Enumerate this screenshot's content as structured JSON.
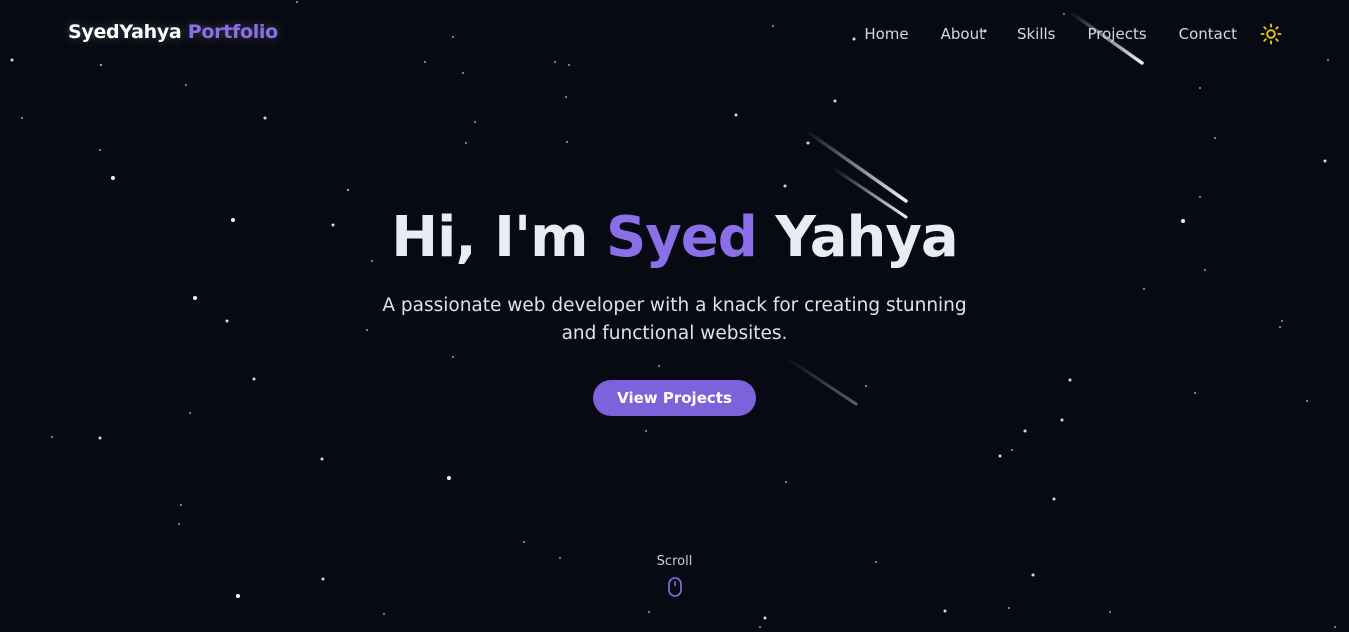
{
  "header": {
    "logo_primary": "SyedYahya",
    "logo_accent": "Portfolio",
    "nav": [
      "Home",
      "About",
      "Skills",
      "Projects",
      "Contact"
    ],
    "theme_icon": "sun-icon"
  },
  "hero": {
    "greeting": "Hi, I'm",
    "name_accent": "Syed",
    "name_rest": "Yahya",
    "tagline": "A passionate web developer with a knack for creating stunning and functional websites.",
    "cta_label": "View Projects"
  },
  "scroll": {
    "label": "Scroll",
    "icon": "mouse-icon"
  },
  "colors": {
    "background": "#070a13",
    "accent": "#8b6fe6",
    "button": "#7d63d9",
    "sun": "#f5c518",
    "text": "#e9ecf3"
  }
}
